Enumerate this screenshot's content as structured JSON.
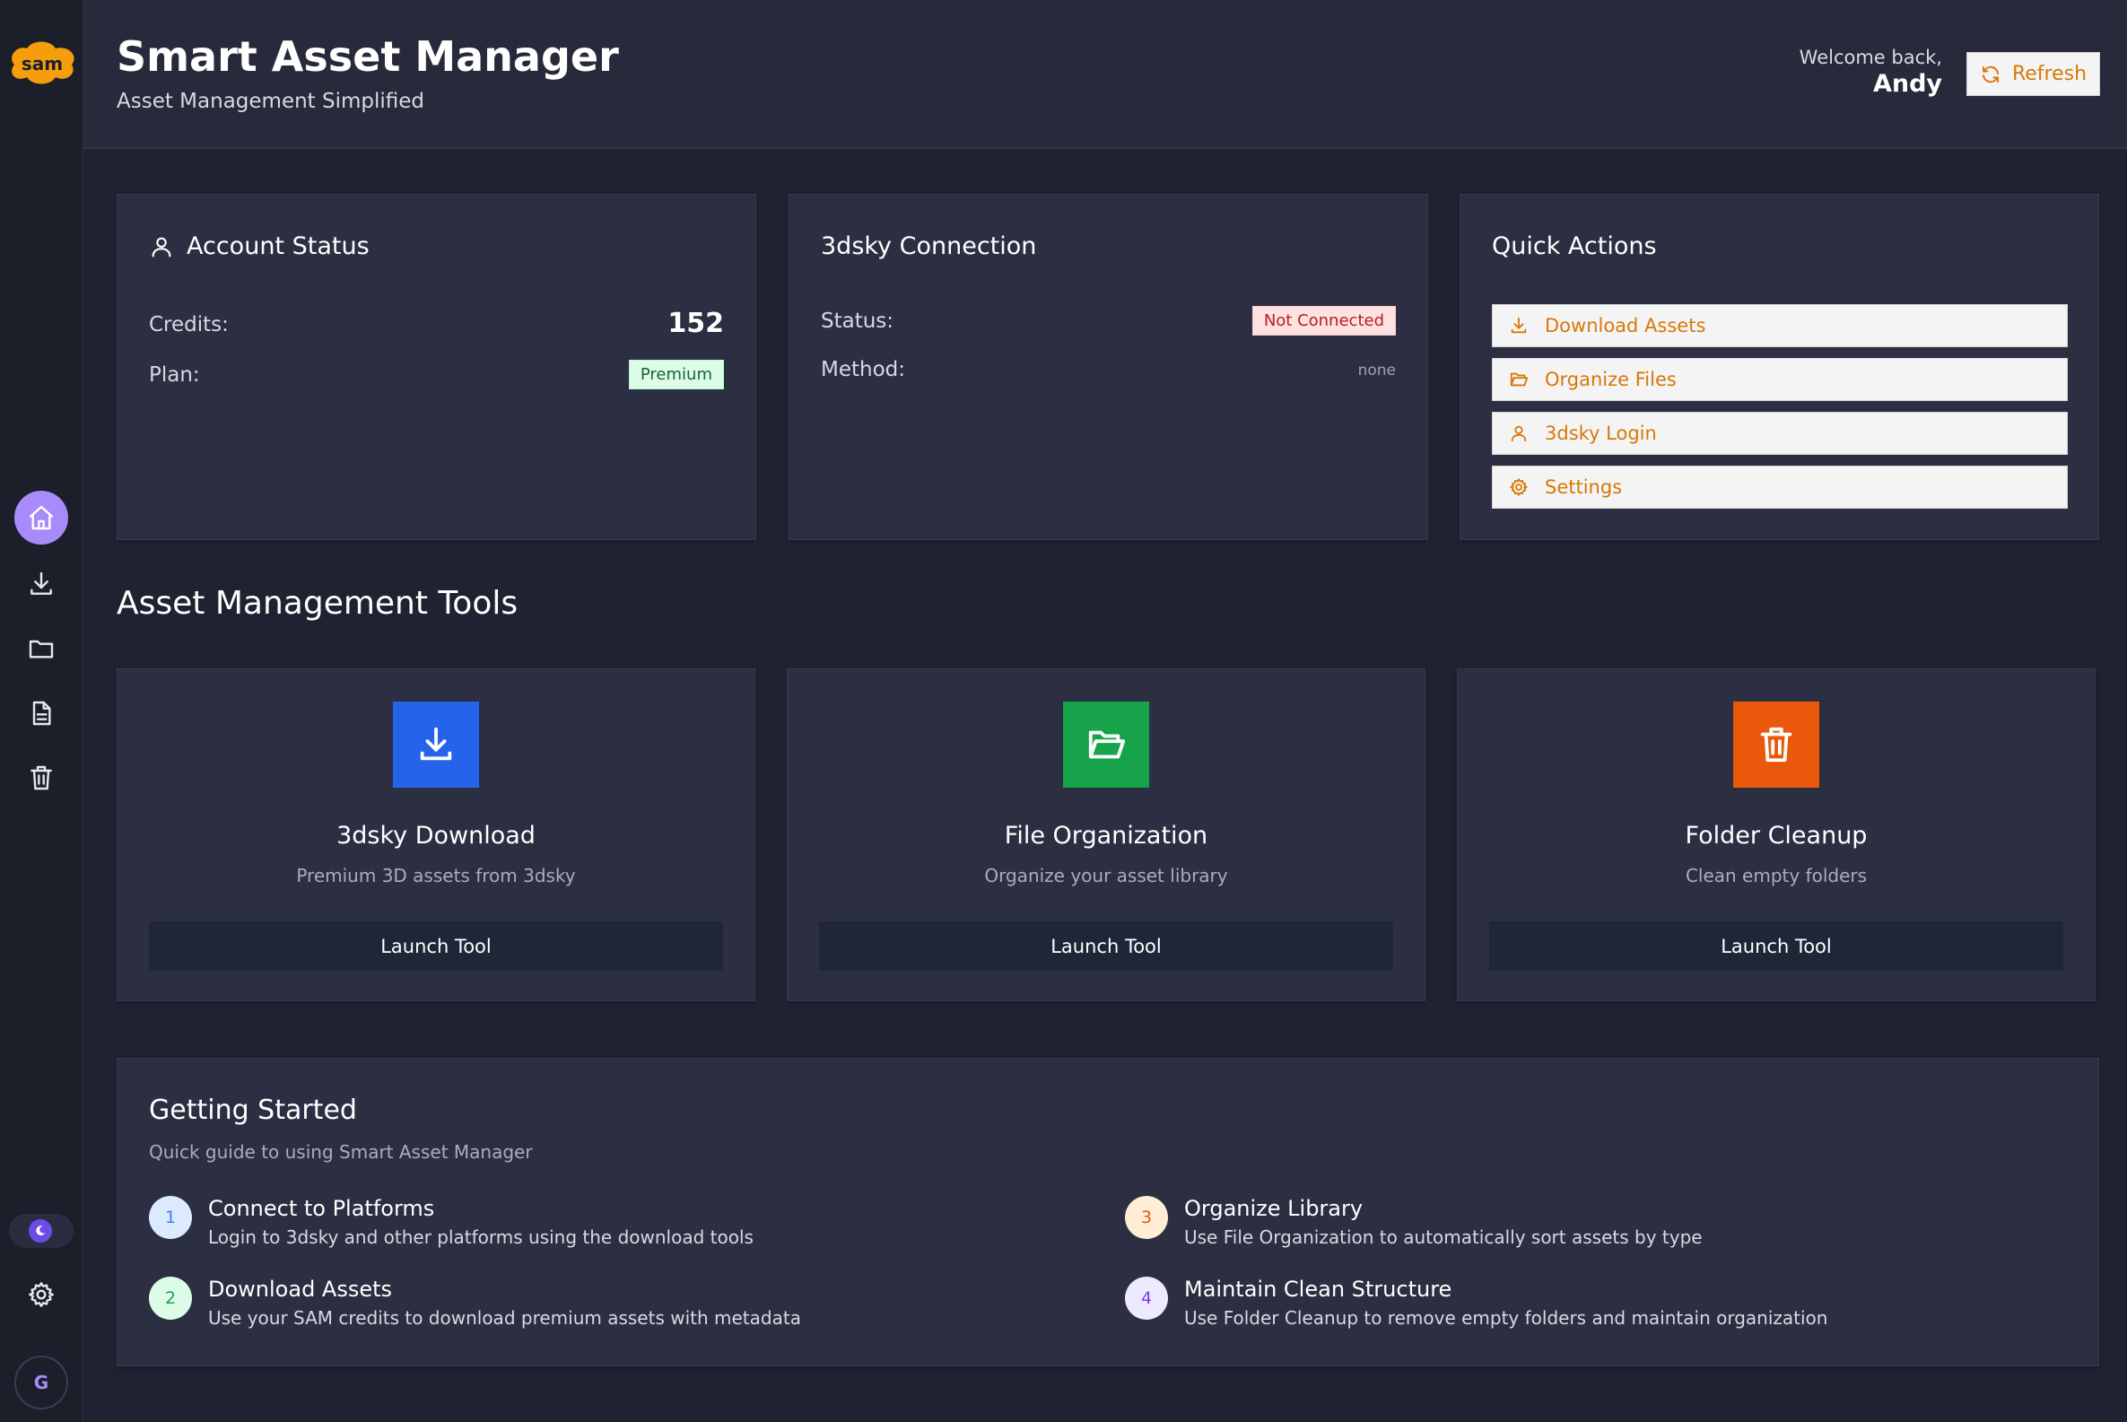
{
  "logo": {
    "text": "sam"
  },
  "sidebar": {
    "items": [
      {
        "name": "home",
        "icon": "home-icon",
        "active": true
      },
      {
        "name": "download",
        "icon": "download-icon"
      },
      {
        "name": "folder",
        "icon": "folder-icon"
      },
      {
        "name": "document",
        "icon": "document-icon"
      },
      {
        "name": "trash",
        "icon": "trash-icon"
      }
    ],
    "theme_toggle_icon": "moon-icon",
    "settings_icon": "gear-icon",
    "avatar_initial": "G"
  },
  "header": {
    "title": "Smart Asset Manager",
    "subtitle": "Asset Management Simplified",
    "welcome_line": "Welcome back,",
    "user_name": "Andy",
    "refresh_label": "Refresh"
  },
  "account": {
    "title": "Account Status",
    "credits_label": "Credits:",
    "credits_value": "152",
    "plan_label": "Plan:",
    "plan_value": "Premium"
  },
  "connection": {
    "title": "3dsky Connection",
    "status_label": "Status:",
    "status_value": "Not Connected",
    "method_label": "Method:",
    "method_value": "none"
  },
  "quick_actions": {
    "title": "Quick Actions",
    "items": [
      {
        "label": "Download Assets",
        "icon": "download-icon"
      },
      {
        "label": "Organize Files",
        "icon": "folder-open-icon"
      },
      {
        "label": "3dsky Login",
        "icon": "user-icon"
      },
      {
        "label": "Settings",
        "icon": "gear-icon"
      }
    ]
  },
  "tools": {
    "section_title": "Asset Management Tools",
    "items": [
      {
        "name": "3dsky Download",
        "desc": "Premium 3D assets from 3dsky",
        "button": "Launch Tool",
        "icon": "download-icon",
        "color": "#2563eb"
      },
      {
        "name": "File Organization",
        "desc": "Organize your asset library",
        "button": "Launch Tool",
        "icon": "folder-open-icon",
        "color": "#16a34a"
      },
      {
        "name": "Folder Cleanup",
        "desc": "Clean empty folders",
        "button": "Launch Tool",
        "icon": "trash-icon",
        "color": "#ea580c"
      }
    ]
  },
  "getting_started": {
    "title": "Getting Started",
    "subtitle": "Quick guide to using Smart Asset Manager",
    "steps": [
      {
        "num": "1",
        "title": "Connect to Platforms",
        "desc": "Login to 3dsky and other platforms using the download tools",
        "color": "#3b82f6",
        "bg": "#dbeafe"
      },
      {
        "num": "2",
        "title": "Download Assets",
        "desc": "Use your SAM credits to download premium assets with metadata",
        "color": "#16a34a",
        "bg": "#dcfce7"
      },
      {
        "num": "3",
        "title": "Organize Library",
        "desc": "Use File Organization to automatically sort assets by type",
        "color": "#ea580c",
        "bg": "#ffedd5"
      },
      {
        "num": "4",
        "title": "Maintain Clean Structure",
        "desc": "Use Folder Cleanup to remove empty folders and maintain organization",
        "color": "#7c3aed",
        "bg": "#ede9fe"
      }
    ]
  }
}
